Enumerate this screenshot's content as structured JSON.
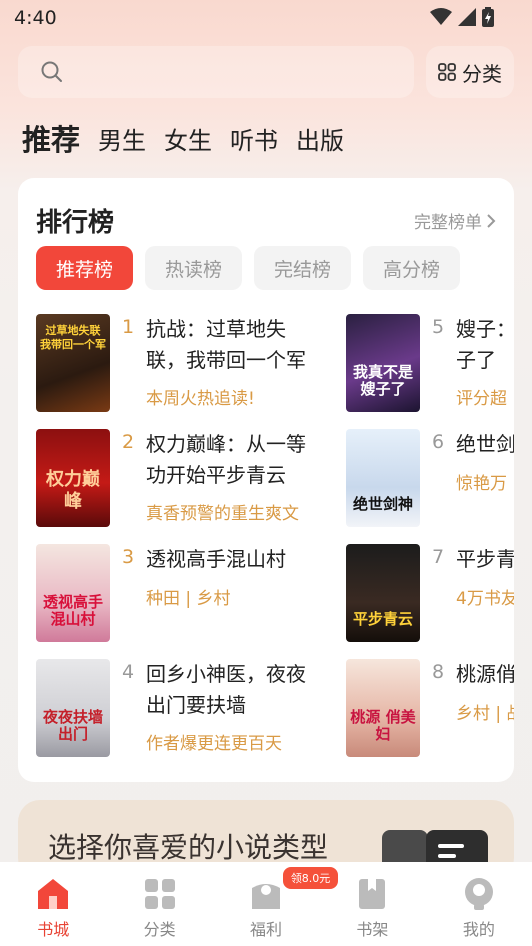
{
  "status_bar": {
    "time": "4:40"
  },
  "search": {
    "placeholder": ""
  },
  "category_button": {
    "label": "分类"
  },
  "top_tabs": [
    {
      "label": "推荐",
      "active": true
    },
    {
      "label": "男生",
      "active": false
    },
    {
      "label": "女生",
      "active": false
    },
    {
      "label": "听书",
      "active": false
    },
    {
      "label": "出版",
      "active": false
    }
  ],
  "ranking": {
    "title": "排行榜",
    "more_label": "完整榜单",
    "chips": [
      {
        "label": "推荐榜",
        "active": true
      },
      {
        "label": "热读榜",
        "active": false
      },
      {
        "label": "完结榜",
        "active": false
      },
      {
        "label": "高分榜",
        "active": false
      }
    ],
    "books": [
      {
        "rank": "1",
        "title": "抗战：过草地失联，我带回一个军",
        "tag": "本周火热追读!",
        "cover_text": "过草地失联 我带回一个军"
      },
      {
        "rank": "2",
        "title": "权力巅峰：从一等功开始平步青云",
        "tag": "真香预警的重生爽文",
        "cover_text": "权力巅峰"
      },
      {
        "rank": "3",
        "title": "透视高手混山村",
        "tag": "种田 | 乡村",
        "cover_text": "透视高手 混山村"
      },
      {
        "rank": "4",
        "title": "回乡小神医，夜夜出门要扶墙",
        "tag": "作者爆更连更百天",
        "cover_text": "夜夜扶墙 出门"
      },
      {
        "rank": "5",
        "title": "嫂子：子了",
        "tag": "评分超",
        "cover_text": "我真不是 嫂子了"
      },
      {
        "rank": "6",
        "title": "绝世剑",
        "tag": "惊艳万",
        "cover_text": "绝世剑神"
      },
      {
        "rank": "7",
        "title": "平步青",
        "tag": "4万书友",
        "cover_text": "平步青云"
      },
      {
        "rank": "8",
        "title": "桃源俏",
        "tag": "乡村 | 战",
        "cover_text": "桃源 俏美妇"
      }
    ]
  },
  "genre_banner": {
    "text": "选择你喜爱的小说类型"
  },
  "bottom_nav": {
    "items": [
      {
        "label": "书城",
        "active": true
      },
      {
        "label": "分类",
        "active": false
      },
      {
        "label": "福利",
        "active": false
      },
      {
        "label": "书架",
        "active": false
      },
      {
        "label": "我的",
        "active": false
      }
    ],
    "welfare_badge": "领8.0元"
  },
  "colors": {
    "accent": "#f2473a",
    "tag": "#d99a45"
  },
  "icons": [
    "wifi-icon",
    "signal-icon",
    "battery-icon",
    "search-icon",
    "grid-icon",
    "chevron-right-icon",
    "home-icon",
    "category-icon",
    "gift-icon",
    "bookshelf-icon",
    "profile-icon"
  ]
}
